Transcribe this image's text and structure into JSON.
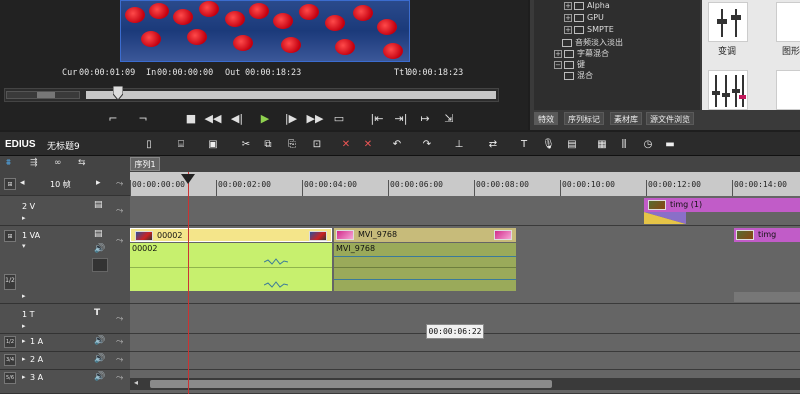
{
  "preview": {
    "cur_label": "Cur",
    "cur_value": "00:00:01:09",
    "in_label": "In",
    "in_value": "00:00:00:00",
    "out_label": "Out",
    "out_value": "00:00:18:23",
    "ttl_label": "Ttl",
    "ttl_value": "00:00:18:23"
  },
  "effects": {
    "tree": [
      {
        "label": "Alpha",
        "expander": "+"
      },
      {
        "label": "GPU",
        "expander": "+"
      },
      {
        "label": "SMPTE",
        "expander": "+"
      },
      {
        "label": "音频淡入淡出",
        "expander": ""
      },
      {
        "label": "字幕混合",
        "expander": "+"
      },
      {
        "label": "键",
        "expander": "−"
      },
      {
        "label": "混合",
        "expander": ""
      }
    ],
    "thumb_labels": [
      "变调",
      "图形"
    ],
    "tabs": [
      "特效",
      "序列标记",
      "素材库",
      "源文件浏览"
    ]
  },
  "timeline": {
    "app_name": "EDIUS",
    "project_name": "无标题9",
    "sequence_tab": "序列1",
    "zoom_label": "10 帧",
    "ruler_ticks": [
      "00:00:00:00",
      "00:00:02:00",
      "00:00:04:00",
      "00:00:06:00",
      "00:00:08:00",
      "00:00:10:00",
      "00:00:12:00",
      "00:00:14:00"
    ],
    "tracks": {
      "v2": "2 V",
      "va1": "1 VA",
      "t1": "1 T",
      "a1": "1 A",
      "a2": "2 A",
      "a3": "3 A"
    },
    "clips": {
      "v2_timg": "timg (1)",
      "va_00002": "00002",
      "va_mvi": "MVI_9768",
      "va_timg": "timg",
      "a_00002": "00002",
      "a_mvi": "MVI_9768"
    },
    "tooltip": "00:00:06:22"
  },
  "colors": {
    "clip_video": "#f4e58a",
    "clip_audio": "#c7f06e",
    "clip_mvi": "#c7bb7a",
    "clip_timg": "#c15cc8",
    "playhead": "#cc3333"
  }
}
